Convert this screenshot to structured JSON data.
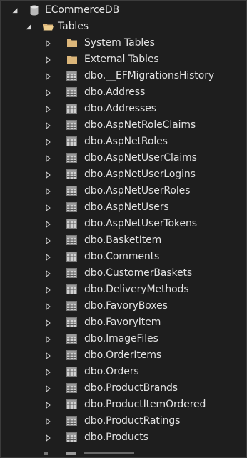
{
  "colors": {
    "background": "#1e1e1e",
    "text": "#e2e2e2",
    "folder": "#dcb67a",
    "table_icon": "#c8c8c8"
  },
  "tree": {
    "database": {
      "label": "ECommerceDB",
      "icon": "database-icon",
      "expanded": true
    },
    "tables_folder": {
      "label": "Tables",
      "icon": "folder-open-icon",
      "expanded": true
    },
    "subfolders": [
      {
        "label": "System Tables",
        "icon": "folder-icon"
      },
      {
        "label": "External Tables",
        "icon": "folder-icon"
      }
    ],
    "tables": [
      {
        "label": "dbo.__EFMigrationsHistory",
        "icon": "table-icon"
      },
      {
        "label": "dbo.Address",
        "icon": "table-icon"
      },
      {
        "label": "dbo.Addresses",
        "icon": "table-icon"
      },
      {
        "label": "dbo.AspNetRoleClaims",
        "icon": "table-icon"
      },
      {
        "label": "dbo.AspNetRoles",
        "icon": "table-icon"
      },
      {
        "label": "dbo.AspNetUserClaims",
        "icon": "table-icon"
      },
      {
        "label": "dbo.AspNetUserLogins",
        "icon": "table-icon"
      },
      {
        "label": "dbo.AspNetUserRoles",
        "icon": "table-icon"
      },
      {
        "label": "dbo.AspNetUsers",
        "icon": "table-icon"
      },
      {
        "label": "dbo.AspNetUserTokens",
        "icon": "table-icon"
      },
      {
        "label": "dbo.BasketItem",
        "icon": "table-icon"
      },
      {
        "label": "dbo.Comments",
        "icon": "table-icon"
      },
      {
        "label": "dbo.CustomerBaskets",
        "icon": "table-icon"
      },
      {
        "label": "dbo.DeliveryMethods",
        "icon": "table-icon"
      },
      {
        "label": "dbo.FavoryBoxes",
        "icon": "table-icon"
      },
      {
        "label": "dbo.FavoryItem",
        "icon": "table-icon"
      },
      {
        "label": "dbo.ImageFiles",
        "icon": "table-icon"
      },
      {
        "label": "dbo.OrderItems",
        "icon": "table-icon"
      },
      {
        "label": "dbo.Orders",
        "icon": "table-icon"
      },
      {
        "label": "dbo.ProductBrands",
        "icon": "table-icon"
      },
      {
        "label": "dbo.ProductItemOrdered",
        "icon": "table-icon"
      },
      {
        "label": "dbo.ProductRatings",
        "icon": "table-icon"
      },
      {
        "label": "dbo.Products",
        "icon": "table-icon"
      }
    ]
  }
}
